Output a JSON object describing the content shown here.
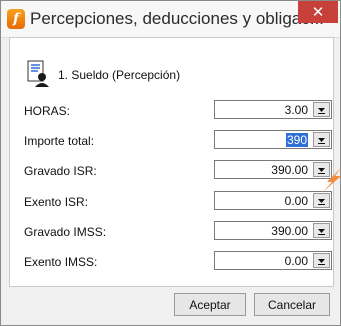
{
  "window": {
    "title": "Percepciones, deducciones y obligac...",
    "close_glyph": "✕"
  },
  "concept": {
    "label": "1. Sueldo (Percepción)",
    "icon": "document-user-icon"
  },
  "rows": [
    {
      "label": "HORAS:",
      "value": "3.00",
      "selected": false
    },
    {
      "label": "Importe total:",
      "value": "390",
      "selected": true
    },
    {
      "label": "Gravado ISR:",
      "value": "390.00",
      "selected": false
    },
    {
      "label": "Exento ISR:",
      "value": "0.00",
      "selected": false
    },
    {
      "label": "Gravado IMSS:",
      "value": "390.00",
      "selected": false
    },
    {
      "label": "Exento IMSS:",
      "value": "0.00",
      "selected": false
    }
  ],
  "buttons": {
    "accept": "Aceptar",
    "cancel": "Cancelar"
  },
  "colors": {
    "accent_orange": "#e66a0a",
    "close_red": "#c7413a",
    "selection_blue": "#2f6fd6"
  }
}
